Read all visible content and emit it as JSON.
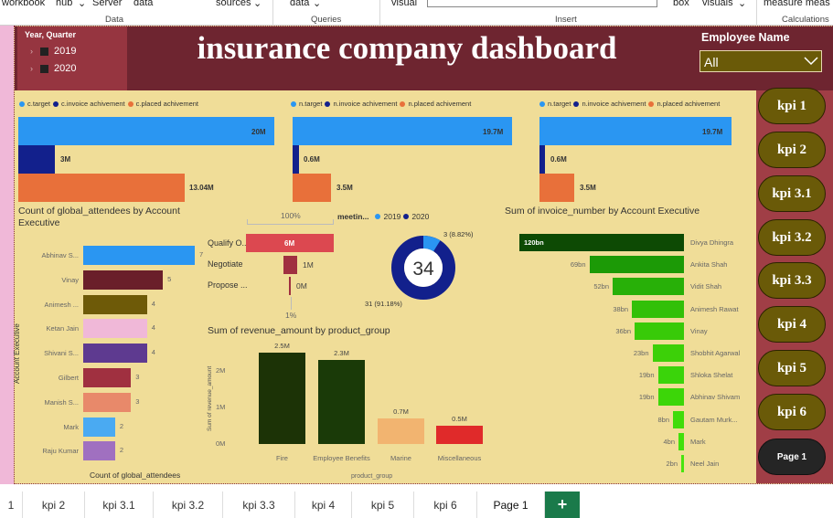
{
  "ribbon": {
    "items": [
      "workbook",
      "hub",
      "Server",
      "data",
      "sources",
      "data",
      "visual",
      "box",
      "visuals",
      "measure meas"
    ],
    "groups": [
      "Data",
      "Queries",
      "Insert",
      "Calculations"
    ]
  },
  "slicer": {
    "title": "Year, Quarter",
    "opt1": "2019",
    "opt2": "2020"
  },
  "header": {
    "title": "insurance company dashboard"
  },
  "employee": {
    "label": "Employee Name",
    "value": "All"
  },
  "bars1": {
    "legend": [
      "c.target",
      "c.invoice achivement",
      "c.placed achivement"
    ],
    "labels": [
      "20M",
      "3M",
      "13.04M"
    ]
  },
  "bars2": {
    "legend": [
      "n.target",
      "n.invoice achivement",
      "n.placed achivement"
    ],
    "labels": [
      "19.7M",
      "0.6M",
      "3.5M"
    ]
  },
  "bars3": {
    "legend": [
      "n.target",
      "n.invoice achivement",
      "n.placed achivement"
    ],
    "labels": [
      "19.7M",
      "0.6M",
      "3.5M"
    ]
  },
  "colors": {
    "target": "#2a96f2",
    "invoice": "#12208c",
    "placed": "#e8703a"
  },
  "attendees": {
    "title": "Count of global_attendees by Account Executive",
    "ylabel": "Account Executive",
    "xlabel": "Count of global_attendees",
    "names": [
      "Abhinav S...",
      "Vinay",
      "Animesh ...",
      "Ketan Jain",
      "Shivani S...",
      "Gilbert",
      "Manish S...",
      "Mark",
      "Raju Kumar"
    ],
    "values": [
      7,
      5,
      4,
      4,
      4,
      3,
      3,
      2,
      2
    ],
    "colors": [
      "#2a96f2",
      "#6a1f2a",
      "#6e5a08",
      "#f0b8d8",
      "#5e3a90",
      "#a03040",
      "#e8896a",
      "#4aaaf2",
      "#a070c0"
    ]
  },
  "funnel": {
    "top": "100%",
    "bottom": "1%",
    "labels": [
      "Qualify O...",
      "Negotiate",
      "Propose ..."
    ],
    "values": [
      "6M",
      "1M",
      "0M"
    ]
  },
  "donut": {
    "legend_title": "meetin...",
    "legend": [
      "2019",
      "2020"
    ],
    "center": "34",
    "slice_small": "3 (8.82%)",
    "slice_large": "31 (91.18%)"
  },
  "revenue": {
    "title": "Sum of revenue_amount by product_group",
    "ylabel": "Sum of revenue_amount",
    "xlabel": "product_group",
    "ticks": [
      "2M",
      "1M",
      "0M"
    ],
    "categories": [
      "Fire",
      "Employee Benefits",
      "Marine",
      "Miscellaneous"
    ],
    "labels": [
      "2.5M",
      "2.3M",
      "0.7M",
      "0.5M"
    ]
  },
  "invoice": {
    "title": "Sum of invoice_number by Account Executive",
    "names": [
      "Divya Dhingra",
      "Ankita Shah",
      "Vidit Shah",
      "Animesh Rawat",
      "Vinay",
      "Shobhit Agarwal",
      "Shloka Shelat",
      "Abhinav Shivam",
      "Gautam Murk...",
      "Mark",
      "Neel Jain"
    ],
    "labels": [
      "120bn",
      "69bn",
      "52bn",
      "38bn",
      "36bn",
      "23bn",
      "19bn",
      "19bn",
      "8bn",
      "4bn",
      "2bn"
    ]
  },
  "kpis": [
    "kpi 1",
    "kpi 2",
    "kpi 3.1",
    "kpi 3.2",
    "kpi 3.3",
    "kpi 4",
    "kpi 5",
    "kpi 6"
  ],
  "page_button": "Page 1",
  "tabs": [
    "1",
    "kpi 2",
    "kpi 3.1",
    "kpi 3.2",
    "kpi 3.3",
    "kpi 4",
    "kpi 5",
    "kpi 6",
    "Page 1"
  ],
  "tab_add": "+",
  "chart_data": [
    {
      "type": "bar",
      "title": "",
      "series": [
        {
          "name": "c.target",
          "values": [
            20
          ]
        },
        {
          "name": "c.invoice achivement",
          "values": [
            3
          ]
        },
        {
          "name": "c.placed achivement",
          "values": [
            13.04
          ]
        }
      ]
    },
    {
      "type": "bar",
      "title": "",
      "series": [
        {
          "name": "n.target",
          "values": [
            19.7
          ]
        },
        {
          "name": "n.invoice achivement",
          "values": [
            0.6
          ]
        },
        {
          "name": "n.placed achivement",
          "values": [
            3.5
          ]
        }
      ]
    },
    {
      "type": "bar",
      "title": "",
      "series": [
        {
          "name": "n.target",
          "values": [
            19.7
          ]
        },
        {
          "name": "n.invoice achivement",
          "values": [
            0.6
          ]
        },
        {
          "name": "n.placed achivement",
          "values": [
            3.5
          ]
        }
      ]
    },
    {
      "type": "bar",
      "title": "Count of global_attendees by Account Executive",
      "categories": [
        "Abhinav S...",
        "Vinay",
        "Animesh ...",
        "Ketan Jain",
        "Shivani S...",
        "Gilbert",
        "Manish S...",
        "Mark",
        "Raju Kumar"
      ],
      "values": [
        7,
        5,
        4,
        4,
        4,
        3,
        3,
        2,
        2
      ]
    },
    {
      "type": "bar",
      "title": "",
      "categories": [
        "Qualify O...",
        "Negotiate",
        "Propose ..."
      ],
      "values": [
        6,
        1,
        0
      ]
    },
    {
      "type": "pie",
      "title": "",
      "categories": [
        "2019",
        "2020"
      ],
      "values": [
        3,
        31
      ]
    },
    {
      "type": "bar",
      "title": "Sum of revenue_amount by product_group",
      "categories": [
        "Fire",
        "Employee Benefits",
        "Marine",
        "Miscellaneous"
      ],
      "values": [
        2.5,
        2.3,
        0.7,
        0.5
      ],
      "ylim": [
        0,
        2.5
      ]
    },
    {
      "type": "bar",
      "title": "Sum of invoice_number by Account Executive",
      "categories": [
        "Divya Dhingra",
        "Ankita Shah",
        "Vidit Shah",
        "Animesh Rawat",
        "Vinay",
        "Shobhit Agarwal",
        "Shloka Shelat",
        "Abhinav Shivam",
        "Gautam Murk...",
        "Mark",
        "Neel Jain"
      ],
      "values": [
        120,
        69,
        52,
        38,
        36,
        23,
        19,
        19,
        8,
        4,
        2
      ]
    }
  ]
}
